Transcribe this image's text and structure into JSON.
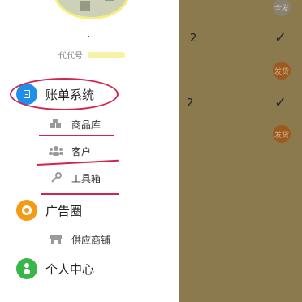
{
  "overlay": {
    "badges": [
      "全发",
      "发货",
      "发货"
    ],
    "numbers": [
      "2",
      "2"
    ],
    "check_symbol": "✓"
  },
  "drawer": {
    "dot": ".",
    "code_label": "代代号",
    "menu": {
      "billing": "账单系统",
      "products": "商品库",
      "customers": "客户",
      "toolbox": "工具箱",
      "ad_circle": "广告圈",
      "supply_shop": "供应商铺",
      "personal_center": "个人中心"
    }
  },
  "colors": {
    "accent_blue": "#1f8fe9",
    "accent_orange": "#f39b16",
    "accent_green": "#39b54a",
    "annotation_red": "#d3244d"
  }
}
